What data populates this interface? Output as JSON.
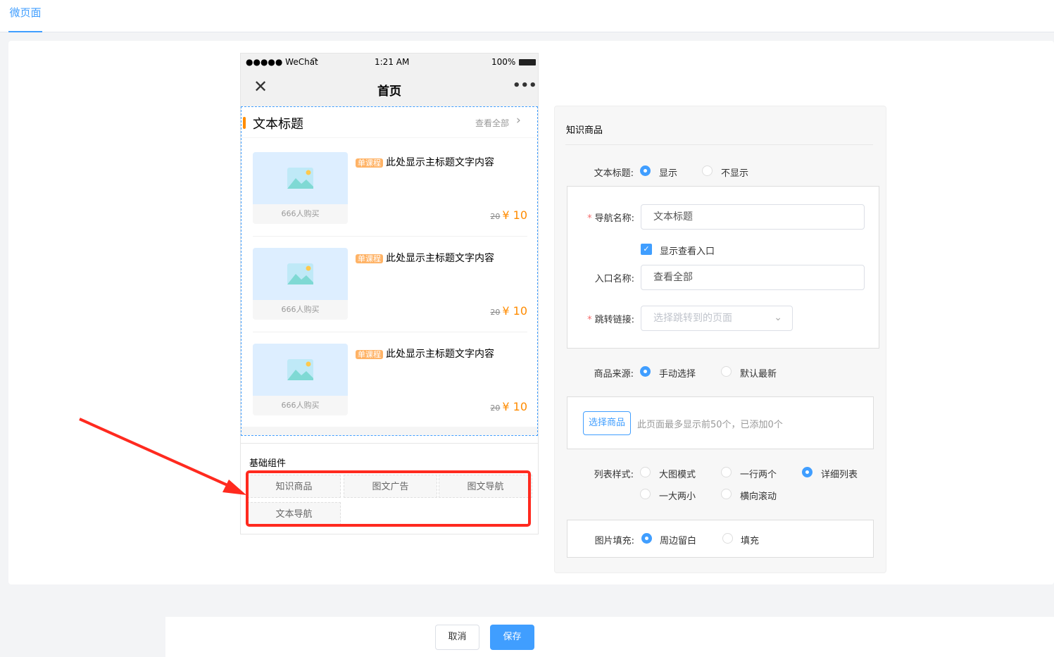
{
  "tabs": [
    {
      "label": "微页面",
      "active": true
    }
  ],
  "phone": {
    "status": {
      "carrier": "●●●●● WeChat",
      "time": "1:21 AM",
      "battery": "100%"
    },
    "nav_title": "首页",
    "section": {
      "title": "文本标题",
      "view_all": "查看全部"
    },
    "items": [
      {
        "tag": "单课程",
        "title": "此处显示主标题文字内容",
        "buyers": "666人购买",
        "old_price": "20",
        "price": "¥ 10"
      },
      {
        "tag": "单课程",
        "title": "此处显示主标题文字内容",
        "buyers": "666人购买",
        "old_price": "20",
        "price": "¥ 10"
      },
      {
        "tag": "单课程",
        "title": "此处显示主标题文字内容",
        "buyers": "666人购买",
        "old_price": "20",
        "price": "¥ 10"
      }
    ],
    "components": {
      "title": "基础组件",
      "buttons": [
        "知识商品",
        "图文广告",
        "图文导航",
        "文本导航"
      ]
    }
  },
  "panel": {
    "title": "知识商品",
    "text_title": {
      "label": "文本标题:",
      "options": [
        "显示",
        "不显示"
      ],
      "selected": 0
    },
    "nav_name": {
      "label": "导航名称:",
      "value": "文本标题"
    },
    "show_entry": {
      "label": "显示查看入口",
      "checked": true
    },
    "entry_name": {
      "label": "入口名称:",
      "value": "查看全部"
    },
    "jump_link": {
      "label": "跳转链接:",
      "placeholder": "选择跳转到的页面"
    },
    "source": {
      "label": "商品来源:",
      "options": [
        "手动选择",
        "默认最新"
      ],
      "selected": 0
    },
    "select_goods": {
      "button": "选择商品",
      "hint": "此页面最多显示前50个，已添加0个"
    },
    "list_style": {
      "label": "列表样式:",
      "options": [
        "大图模式",
        "一行两个",
        "详细列表",
        "一大两小",
        "横向滚动"
      ],
      "selected": 2
    },
    "image_fill": {
      "label": "图片填充:",
      "options": [
        "周边留白",
        "填充"
      ],
      "selected": 0
    }
  },
  "footer": {
    "cancel": "取消",
    "save": "保存"
  },
  "colors": {
    "primary": "#409eff",
    "accent": "#ff8b00",
    "annotation": "#ff2a1f"
  }
}
